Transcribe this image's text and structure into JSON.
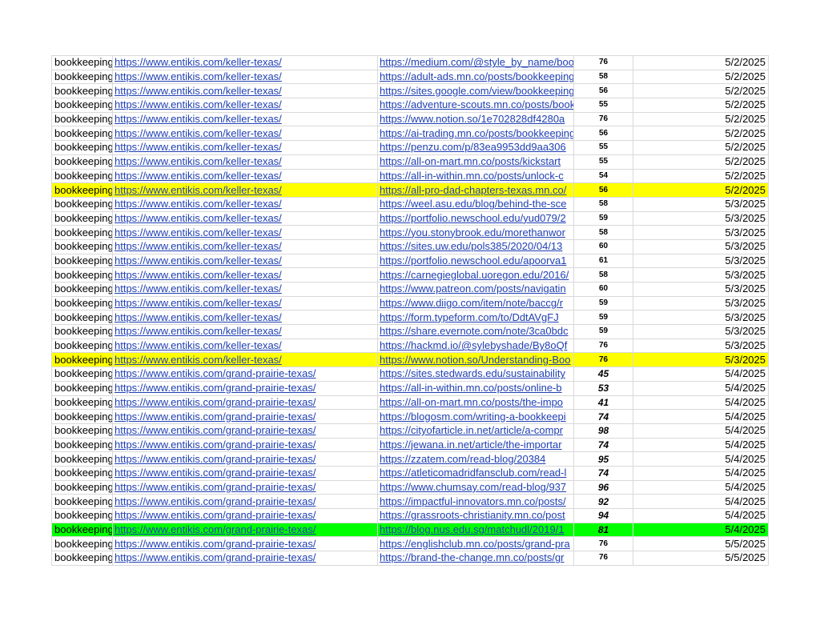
{
  "rows": [
    {
      "keyword": "bookkeeping",
      "target": "https://www.entikis.com/keller-texas/",
      "source": "https://medium.com/@style_by_name/bookkeeping",
      "da": "76",
      "date": "5/2/2025",
      "highlight": ""
    },
    {
      "keyword": "bookkeeping",
      "target": "https://www.entikis.com/keller-texas/",
      "source": "https://adult-ads.mn.co/posts/bookkeeping",
      "da": "58",
      "date": "5/2/2025",
      "highlight": ""
    },
    {
      "keyword": "bookkeeping",
      "target": "https://www.entikis.com/keller-texas/",
      "source": "https://sites.google.com/view/bookkeeping",
      "da": "56",
      "date": "5/2/2025",
      "highlight": ""
    },
    {
      "keyword": "bookkeeping",
      "target": "https://www.entikis.com/keller-texas/",
      "source": "https://adventure-scouts.mn.co/posts/bookkeeping",
      "da": "55",
      "date": "5/2/2025",
      "highlight": ""
    },
    {
      "keyword": "bookkeeping",
      "target": "https://www.entikis.com/keller-texas/",
      "source": "https://www.notion.so/1e702828df4280a",
      "da": "76",
      "date": "5/2/2025",
      "highlight": ""
    },
    {
      "keyword": "bookkeeping",
      "target": "https://www.entikis.com/keller-texas/",
      "source": "https://ai-trading.mn.co/posts/bookkeeping",
      "da": "56",
      "date": "5/2/2025",
      "highlight": ""
    },
    {
      "keyword": "bookkeeping",
      "target": "https://www.entikis.com/keller-texas/",
      "source": "https://penzu.com/p/83ea9953dd9aa306",
      "da": "55",
      "date": "5/2/2025",
      "highlight": ""
    },
    {
      "keyword": "bookkeeping",
      "target": "https://www.entikis.com/keller-texas/",
      "source": "https://all-on-mart.mn.co/posts/kickstart",
      "da": "55",
      "date": "5/2/2025",
      "highlight": ""
    },
    {
      "keyword": "bookkeeping",
      "target": "https://www.entikis.com/keller-texas/",
      "source": "https://all-in-within.mn.co/posts/unlock-c",
      "da": "54",
      "date": "5/2/2025",
      "highlight": ""
    },
    {
      "keyword": "bookkeeping",
      "target": "https://www.entikis.com/keller-texas/",
      "source": "https://all-pro-dad-chapters-texas.mn.co/",
      "da": "56",
      "date": "5/2/2025",
      "highlight": "yellow"
    },
    {
      "keyword": "bookkeeping",
      "target": "https://www.entikis.com/keller-texas/",
      "source": "https://weel.asu.edu/blog/behind-the-sce",
      "da": "58",
      "date": "5/3/2025",
      "highlight": ""
    },
    {
      "keyword": "bookkeeping",
      "target": "https://www.entikis.com/keller-texas/",
      "source": "https://portfolio.newschool.edu/yud079/2",
      "da": "59",
      "date": "5/3/2025",
      "highlight": ""
    },
    {
      "keyword": "bookkeeping",
      "target": "https://www.entikis.com/keller-texas/",
      "source": "https://you.stonybrook.edu/morethanwor",
      "da": "58",
      "date": "5/3/2025",
      "highlight": ""
    },
    {
      "keyword": "bookkeeping",
      "target": "https://www.entikis.com/keller-texas/",
      "source": "https://sites.uw.edu/pols385/2020/04/13",
      "da": "60",
      "date": "5/3/2025",
      "highlight": ""
    },
    {
      "keyword": "bookkeeping",
      "target": "https://www.entikis.com/keller-texas/",
      "source": "https://portfolio.newschool.edu/apoorva1",
      "da": "61",
      "date": "5/3/2025",
      "highlight": ""
    },
    {
      "keyword": "bookkeeping",
      "target": "https://www.entikis.com/keller-texas/",
      "source": "https://carnegieglobal.uoregon.edu/2016/",
      "da": "58",
      "date": "5/3/2025",
      "highlight": ""
    },
    {
      "keyword": "bookkeeping",
      "target": "https://www.entikis.com/keller-texas/",
      "source": "https://www.patreon.com/posts/navigatin",
      "da": "60",
      "date": "5/3/2025",
      "highlight": ""
    },
    {
      "keyword": "bookkeeping",
      "target": "https://www.entikis.com/keller-texas/",
      "source": "https://www.diigo.com/item/note/baccg/r",
      "da": "59",
      "date": "5/3/2025",
      "highlight": ""
    },
    {
      "keyword": "bookkeeping",
      "target": "https://www.entikis.com/keller-texas/",
      "source": "https://form.typeform.com/to/DdtAVgFJ",
      "da": "59",
      "date": "5/3/2025",
      "highlight": ""
    },
    {
      "keyword": "bookkeeping",
      "target": "https://www.entikis.com/keller-texas/",
      "source": "https://share.evernote.com/note/3ca0bdc",
      "da": "59",
      "date": "5/3/2025",
      "highlight": ""
    },
    {
      "keyword": "bookkeeping",
      "target": "https://www.entikis.com/keller-texas/",
      "source": "https://hackmd.io/@sylebyshade/By8oQf",
      "da": "76",
      "date": "5/3/2025",
      "highlight": ""
    },
    {
      "keyword": "bookkeeping",
      "target": "https://www.entikis.com/keller-texas/",
      "source": "https://www.notion.so/Understanding-Boo",
      "da": "76",
      "date": "5/3/2025",
      "highlight": "yellow"
    },
    {
      "keyword": "bookkeeping",
      "target": "https://www.entikis.com/grand-prairie-texas/",
      "source": "https://sites.stedwards.edu/sustainability",
      "da": "45",
      "date": "5/4/2025",
      "highlight": ""
    },
    {
      "keyword": "bookkeeping",
      "target": "https://www.entikis.com/grand-prairie-texas/",
      "source": "https://all-in-within.mn.co/posts/online-b",
      "da": "53",
      "date": "5/4/2025",
      "highlight": ""
    },
    {
      "keyword": "bookkeeping",
      "target": "https://www.entikis.com/grand-prairie-texas/",
      "source": "https://all-on-mart.mn.co/posts/the-impo",
      "da": "41",
      "date": "5/4/2025",
      "highlight": ""
    },
    {
      "keyword": "bookkeeping",
      "target": "https://www.entikis.com/grand-prairie-texas/",
      "source": "https://blogosm.com/writing-a-bookkeepi",
      "da": "74",
      "date": "5/4/2025",
      "highlight": ""
    },
    {
      "keyword": "bookkeeping",
      "target": "https://www.entikis.com/grand-prairie-texas/",
      "source": "https://cityofarticle.in.net/article/a-compr",
      "da": "98",
      "date": "5/4/2025",
      "highlight": ""
    },
    {
      "keyword": "bookkeeping",
      "target": "https://www.entikis.com/grand-prairie-texas/",
      "source": "https://jewana.in.net/article/the-importar",
      "da": "74",
      "date": "5/4/2025",
      "highlight": ""
    },
    {
      "keyword": "bookkeeping",
      "target": "https://www.entikis.com/grand-prairie-texas/",
      "source": "https://zzatem.com/read-blog/20384",
      "da": "95",
      "date": "5/4/2025",
      "highlight": ""
    },
    {
      "keyword": "bookkeeping",
      "target": "https://www.entikis.com/grand-prairie-texas/",
      "source": "https://atleticomadridfansclub.com/read-l",
      "da": "74",
      "date": "5/4/2025",
      "highlight": ""
    },
    {
      "keyword": "bookkeeping",
      "target": "https://www.entikis.com/grand-prairie-texas/",
      "source": "https://www.chumsay.com/read-blog/937",
      "da": "96",
      "date": "5/4/2025",
      "highlight": ""
    },
    {
      "keyword": "bookkeeping",
      "target": "https://www.entikis.com/grand-prairie-texas/",
      "source": "https://impactful-innovators.mn.co/posts/",
      "da": "92",
      "date": "5/4/2025",
      "highlight": ""
    },
    {
      "keyword": "bookkeeping",
      "target": "https://www.entikis.com/grand-prairie-texas/",
      "source": "https://grassroots-christianity.mn.co/post",
      "da": "94",
      "date": "5/4/2025",
      "highlight": ""
    },
    {
      "keyword": "bookkeeping",
      "target": "https://www.entikis.com/grand-prairie-texas/",
      "source": "https://blog.nus.edu.sg/matchudl/2019/1",
      "da": "81",
      "date": "5/4/2025",
      "highlight": "green"
    },
    {
      "keyword": "bookkeeping",
      "target": "https://www.entikis.com/grand-prairie-texas/",
      "source": "https://englishclub.mn.co/posts/grand-pra",
      "da": "76",
      "date": "5/5/2025",
      "highlight": ""
    },
    {
      "keyword": "bookkeeping",
      "target": "https://www.entikis.com/grand-prairie-texas/",
      "source": "https://brand-the-change.mn.co/posts/gr",
      "da": "76",
      "date": "5/5/2025",
      "highlight": ""
    }
  ],
  "style_flags": {
    "big_da_rows_from_index": 22,
    "big_da_rows_to_index": 33
  }
}
